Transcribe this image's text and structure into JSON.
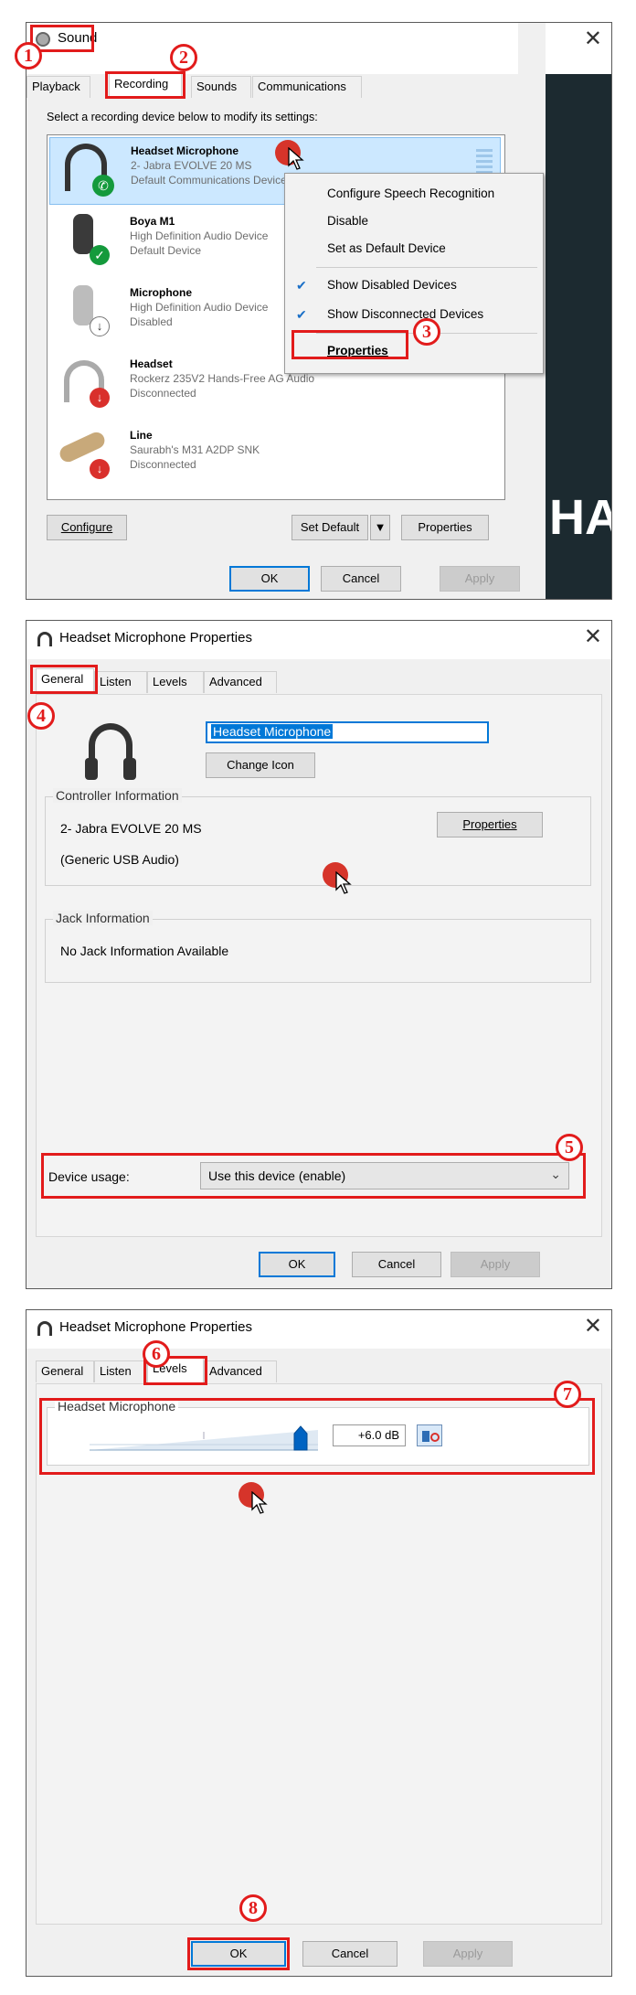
{
  "step_numbers": [
    "1",
    "2",
    "3",
    "4",
    "5",
    "6",
    "7",
    "8"
  ],
  "panel1": {
    "title": "Sound",
    "tabs": [
      "Playback",
      "Recording",
      "Sounds",
      "Communications"
    ],
    "instruction": "Select a recording device below to modify its settings:",
    "devices": [
      {
        "name": "Headset Microphone",
        "line2": "2- Jabra EVOLVE 20 MS",
        "line3": "Default Communications Device",
        "status": "green-phone"
      },
      {
        "name": "Boya M1",
        "line2": "High Definition Audio Device",
        "line3": "Default Device",
        "status": "green-check"
      },
      {
        "name": "Microphone",
        "line2": "High Definition Audio Device",
        "line3": "Disabled",
        "status": "disabled-arrow"
      },
      {
        "name": "Headset",
        "line2": "Rockerz 235V2 Hands-Free AG Audio",
        "line3": "Disconnected",
        "status": "red-arrow"
      },
      {
        "name": "Line",
        "line2": "Saurabh's M31 A2DP SNK",
        "line3": "Disconnected",
        "status": "red-arrow"
      }
    ],
    "context_menu": {
      "items": [
        "Configure Speech Recognition",
        "Disable",
        "Set as Default Device",
        "Show Disabled Devices",
        "Show Disconnected Devices",
        "Properties"
      ]
    },
    "buttons": {
      "configure": "Configure",
      "set_default": "Set Default",
      "properties": "Properties",
      "ok": "OK",
      "cancel": "Cancel",
      "apply": "Apply"
    },
    "background_text": "HA"
  },
  "panel2": {
    "title": "Headset Microphone Properties",
    "tabs": [
      "General",
      "Listen",
      "Levels",
      "Advanced"
    ],
    "device_name": "Headset Microphone",
    "change_icon": "Change Icon",
    "controller_title": "Controller Information",
    "controller_line1": "2- Jabra EVOLVE 20 MS",
    "controller_line2": "(Generic USB Audio)",
    "controller_properties": "Properties",
    "jack_title": "Jack Information",
    "jack_text": "No Jack Information Available",
    "device_usage_label": "Device usage:",
    "device_usage_value": "Use this device (enable)",
    "buttons": {
      "ok": "OK",
      "cancel": "Cancel",
      "apply": "Apply"
    }
  },
  "panel3": {
    "title": "Headset Microphone Properties",
    "tabs": [
      "General",
      "Listen",
      "Levels",
      "Advanced"
    ],
    "levels_group_title": "Headset Microphone",
    "level_value": "+6.0 dB",
    "slider_fraction": 0.95,
    "buttons": {
      "ok": "OK",
      "cancel": "Cancel",
      "apply": "Apply"
    }
  },
  "colors": {
    "annotation_red": "#e21b1b",
    "accent_blue": "#0078d7",
    "selection": "#cce8ff",
    "cursor_dot": "#d6342a"
  }
}
